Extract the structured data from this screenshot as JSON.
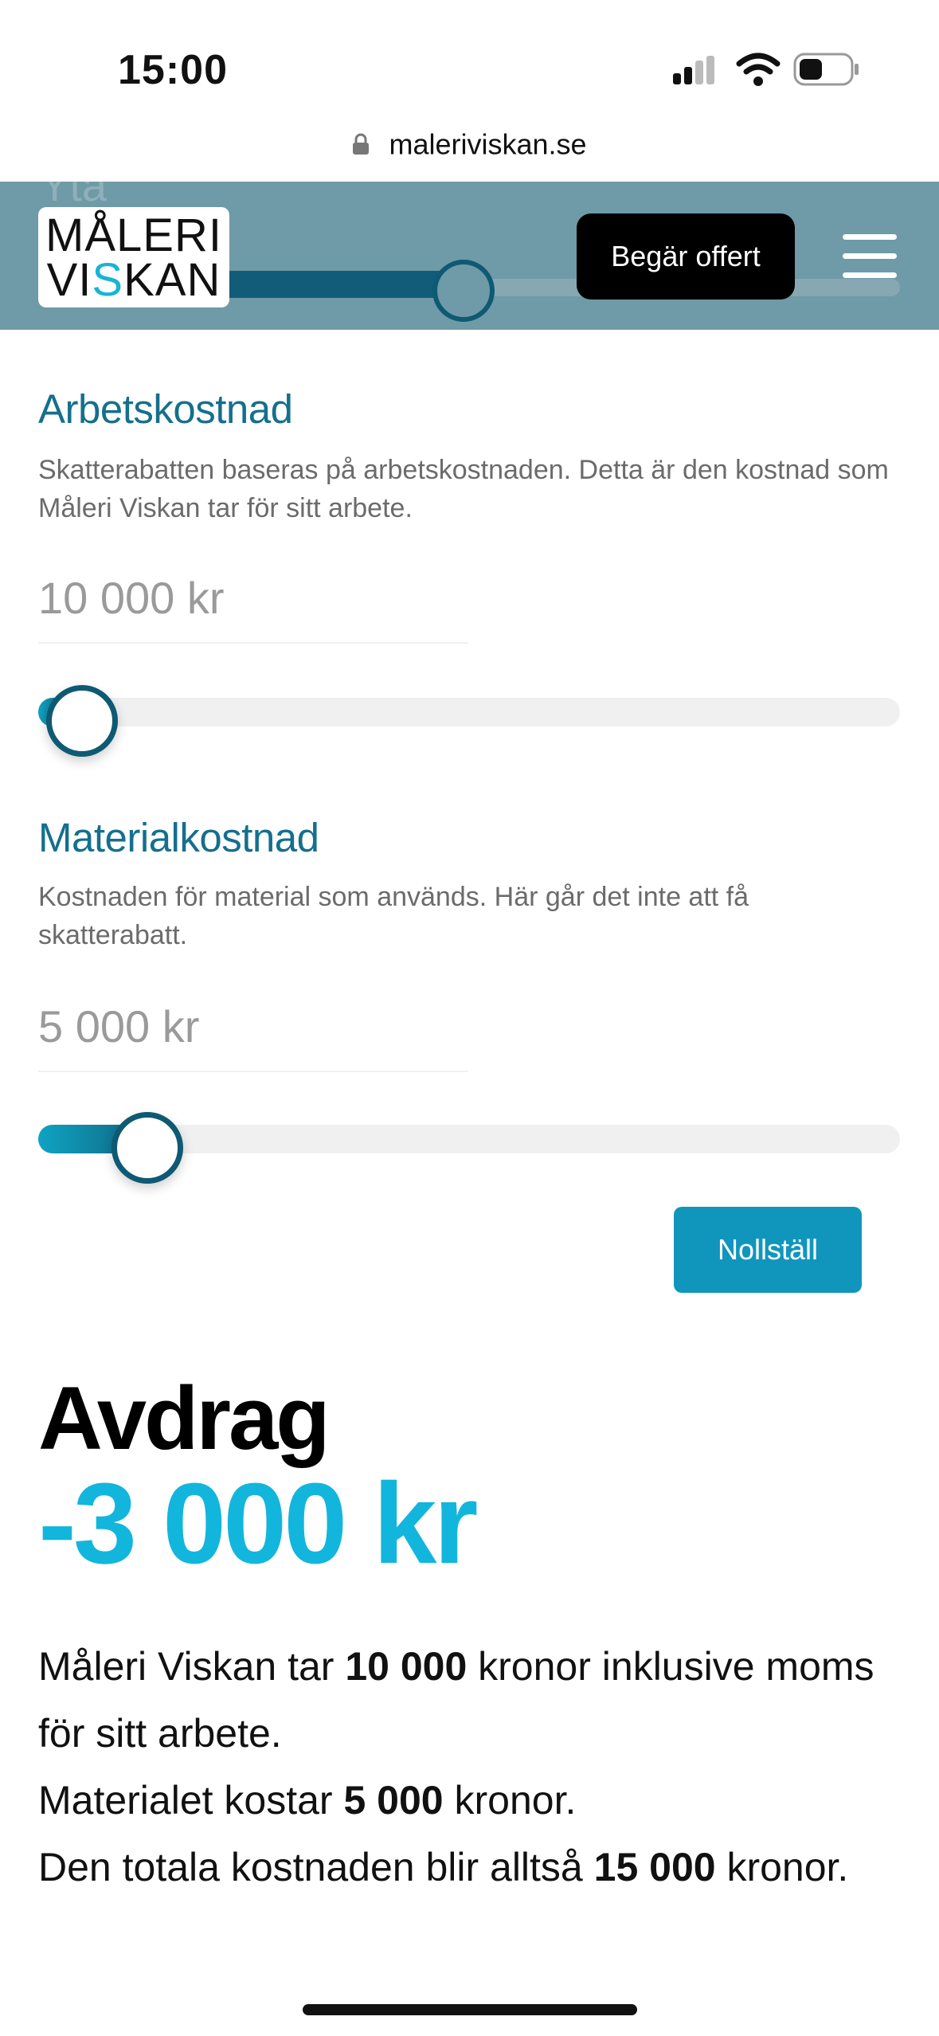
{
  "status_bar": {
    "time": "15:00"
  },
  "browser": {
    "url": "maleriviskan.se"
  },
  "header": {
    "ghost_label": "Yta",
    "logo_line1": "MÅLERI",
    "logo_line2_a": "VI",
    "logo_line2_s": "S",
    "logo_line2_b": "KAN",
    "cta_label": "Begär offert"
  },
  "labor": {
    "title": "Arbetskostnad",
    "description": "Skatterabatten baseras på arbetskostnaden. Detta är den kostnad som Måleri Viskan tar för sitt arbete.",
    "value": "10 000 kr"
  },
  "material": {
    "title": "Materialkostnad",
    "description": "Kostnaden för material som används. Här går det inte att få skatterabatt.",
    "value": "5 000 kr"
  },
  "reset_label": "Nollställ",
  "result": {
    "label": "Avdrag",
    "value": "-3 000 kr"
  },
  "summary": {
    "p1_pre": "Måleri Viskan tar ",
    "p1_bold": "10 000",
    "p1_post": " kronor inklusive moms för sitt arbete.",
    "p2_pre": "Materialet kostar ",
    "p2_bold": "5 000",
    "p2_post": " kronor.",
    "p3_pre": "Den totala kostnaden blir alltså ",
    "p3_bold": "15 000",
    "p3_post": " kronor."
  },
  "colors": {
    "header_bg": "#6f9aa7",
    "accent_title": "#156f8d",
    "accent_result": "#12b6dc",
    "button_reset": "#1096bd"
  },
  "icons": {
    "lock": "lock-icon",
    "menu": "hamburger-menu-icon",
    "signal": "cellular-signal-icon",
    "wifi": "wifi-icon",
    "battery": "battery-icon"
  }
}
